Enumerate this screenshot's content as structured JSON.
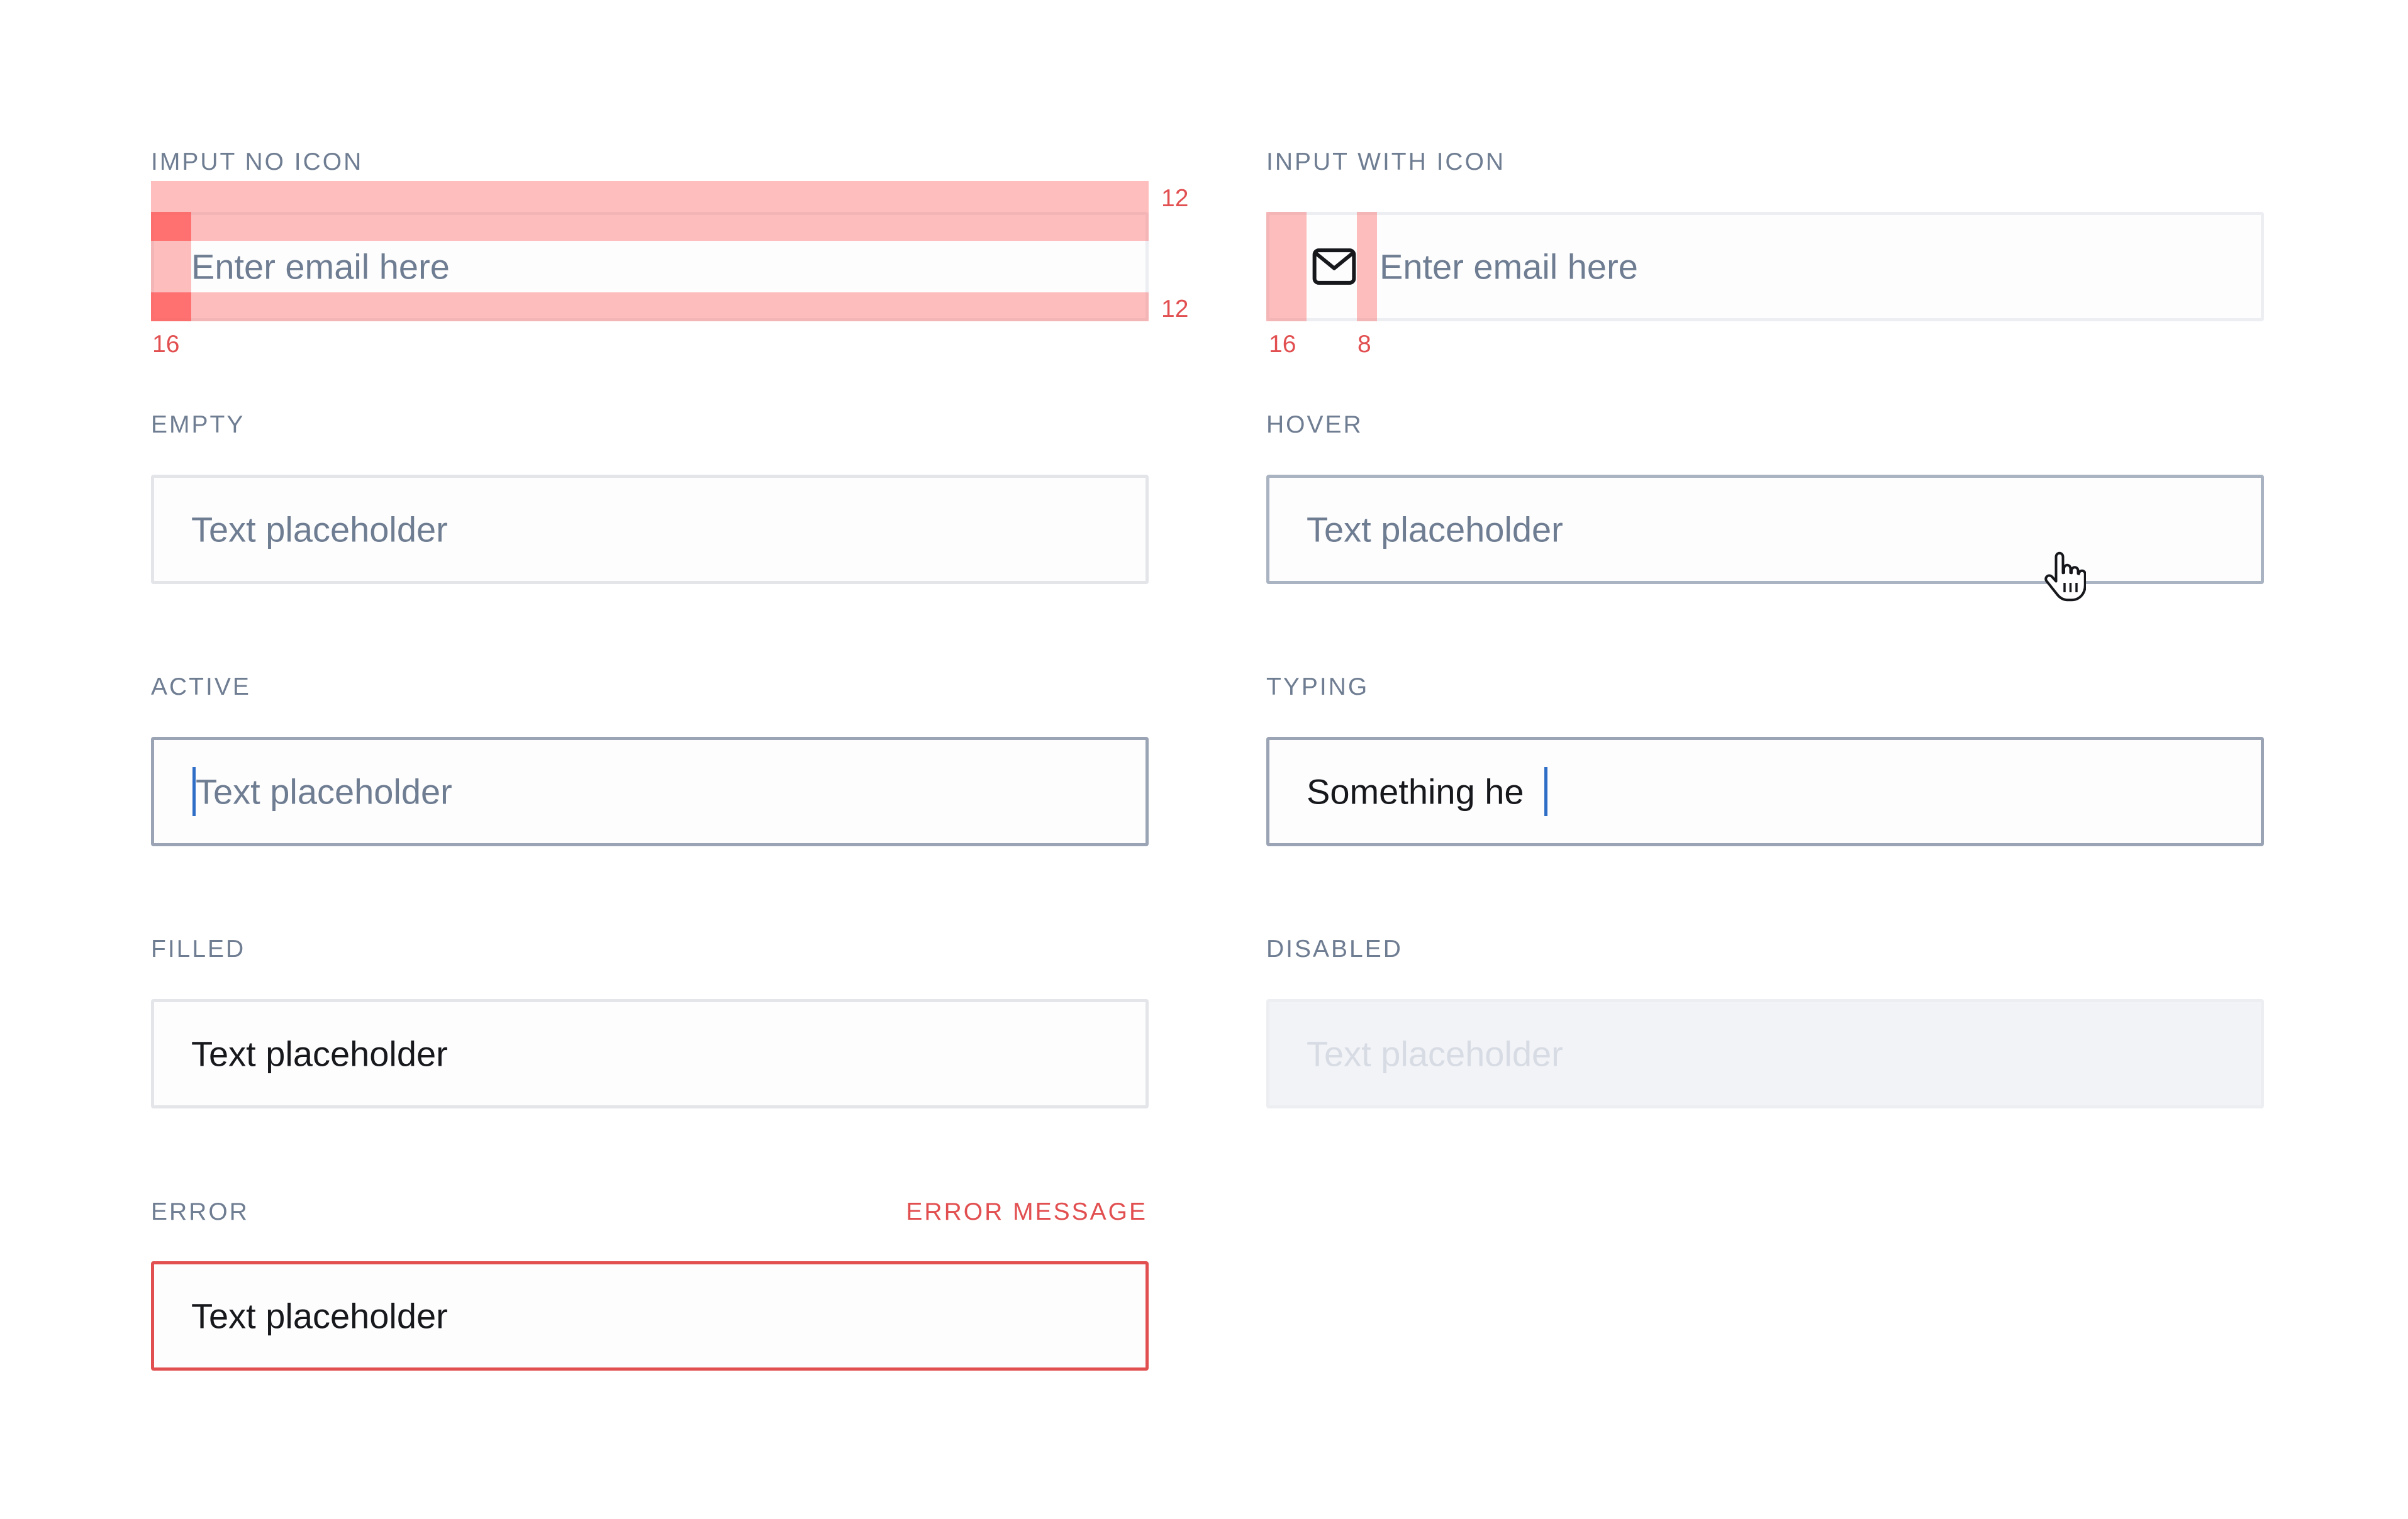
{
  "sections": {
    "no_icon": {
      "label": "IMPUT NO ICON",
      "placeholder": "Enter email here",
      "spacing_top": "12",
      "spacing_bottom": "12",
      "spacing_left": "16"
    },
    "with_icon": {
      "label": "INPUT WITH ICON",
      "placeholder": "Enter email here",
      "icon": "mail-icon",
      "spacing_left": "16",
      "spacing_icon": "8"
    },
    "empty": {
      "label": "EMPTY",
      "placeholder": "Text placeholder"
    },
    "hover": {
      "label": "HOVER",
      "placeholder": "Text placeholder",
      "cursor": "hand-pointer-icon"
    },
    "active": {
      "label": "ACTIVE",
      "placeholder": "Text placeholder"
    },
    "typing": {
      "label": "TYPING",
      "value": "Something he"
    },
    "filled": {
      "label": "FILLED",
      "value": "Text placeholder"
    },
    "disabled": {
      "label": "DISABLED",
      "placeholder": "Text placeholder"
    },
    "error": {
      "label": "ERROR",
      "message": "ERROR MESSAGE",
      "value": "Text placeholder"
    }
  },
  "colors": {
    "label": "#6f7d92",
    "placeholder": "#6f7d92",
    "text": "#16181c",
    "border": "#e3e5e9",
    "border_active": "#9aa4b4",
    "error": "#e24f50",
    "caret": "#2f6ec7",
    "disabled_bg": "#f2f3f7",
    "spacing_overlay": "#ff6e6e"
  }
}
